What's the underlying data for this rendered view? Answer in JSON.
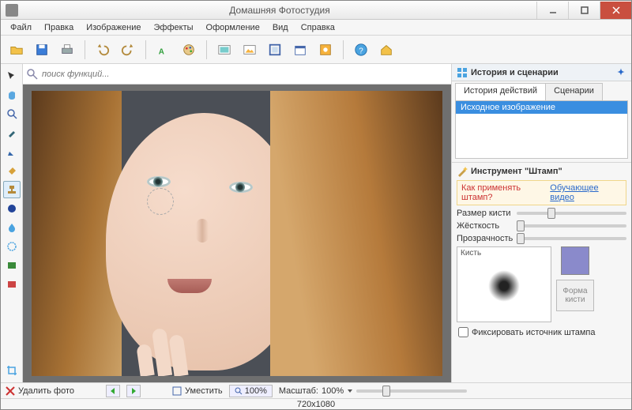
{
  "window": {
    "title": "Домашняя Фотостудия"
  },
  "menu": [
    "Файл",
    "Правка",
    "Изображение",
    "Эффекты",
    "Оформление",
    "Вид",
    "Справка"
  ],
  "search": {
    "placeholder": "поиск функций..."
  },
  "history_panel": {
    "title": "История и сценарии",
    "tab_history": "История действий",
    "tab_scenarios": "Сценарии",
    "items": [
      "Исходное изображение"
    ]
  },
  "tool_panel": {
    "title": "Инструмент \"Штамп\"",
    "tip_q": "Как применять штамп?",
    "tip_link": "Обучающее видео",
    "size_label": "Размер кисти",
    "hardness_label": "Жёсткость",
    "opacity_label": "Прозрачность",
    "brush_label": "Кисть",
    "form_label": "Форма кисти",
    "fix_label": "Фиксировать источник штампа"
  },
  "bottom": {
    "delete": "Удалить фото",
    "fit": "Уместить",
    "zoom_btn": "100%",
    "scale_label": "Масштаб:",
    "scale_value": "100%"
  },
  "status": {
    "dims": "720x1080"
  }
}
